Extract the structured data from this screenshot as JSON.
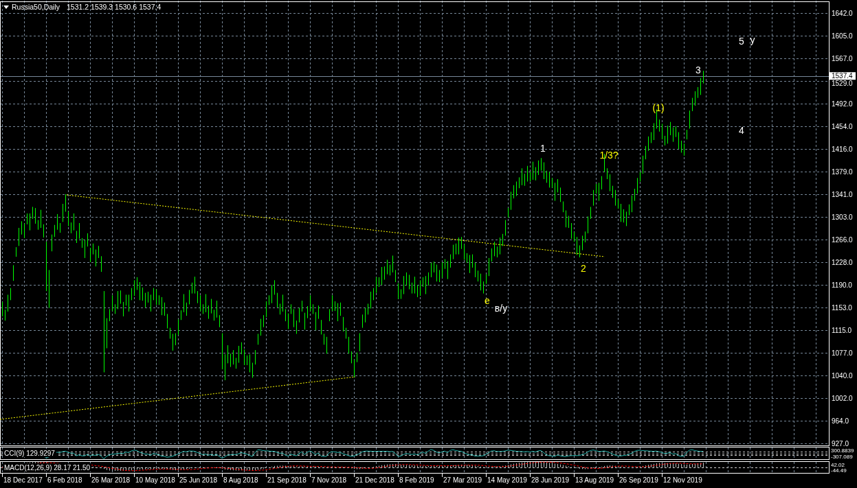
{
  "chart": {
    "title": "Russia50,Daily",
    "ohlc": "1531.2 1539.3 1530.6 1537.4",
    "price_axis": [
      "1642.0",
      "1605.0",
      "1567.0",
      "1529.0",
      "1492.0",
      "1454.0",
      "1416.0",
      "1379.0",
      "1341.0",
      "1303.0",
      "1266.0",
      "1228.0",
      "1190.0",
      "1153.0",
      "1115.0",
      "1077.0",
      "1040.0",
      "1002.0",
      "964.0",
      "927.0"
    ],
    "current_price": "1537.4",
    "wave_labels": [
      {
        "text": "5",
        "color": "#ffffff"
      },
      {
        "text": "у",
        "color": "#ffffff"
      },
      {
        "text": "3",
        "color": "#ffffff"
      },
      {
        "text": "(1)",
        "color": "#ffff00"
      },
      {
        "text": "4",
        "color": "#ffffff"
      },
      {
        "text": "1",
        "color": "#ffffff"
      },
      {
        "text": "1/3?",
        "color": "#ffff00"
      },
      {
        "text": "2",
        "color": "#ffff00"
      },
      {
        "text": "e",
        "color": "#ffff00"
      },
      {
        "text": "в/у",
        "color": "#ffffff"
      }
    ]
  },
  "cci": {
    "label": "CCI(9) 129.9297",
    "axis_labels": [
      "300.8839",
      "-307.089"
    ]
  },
  "macd": {
    "label": "MACD(12,26,9) 28.17 21.50",
    "axis_labels": [
      "42.02",
      "-44.49"
    ]
  },
  "date_axis": [
    "18 Dec 2017",
    "6 Feb 2018",
    "26 Mar 2018",
    "10 May 2018",
    "25 Jun 2018",
    "8 Aug 2018",
    "21 Sep 2018",
    "7 Nov 2018",
    "21 Dec 2018",
    "8 Feb 2019",
    "27 Mar 2019",
    "14 May 2019",
    "28 Jun 2019",
    "13 Aug 2019",
    "26 Sep 2019",
    "12 Nov 2019"
  ]
}
